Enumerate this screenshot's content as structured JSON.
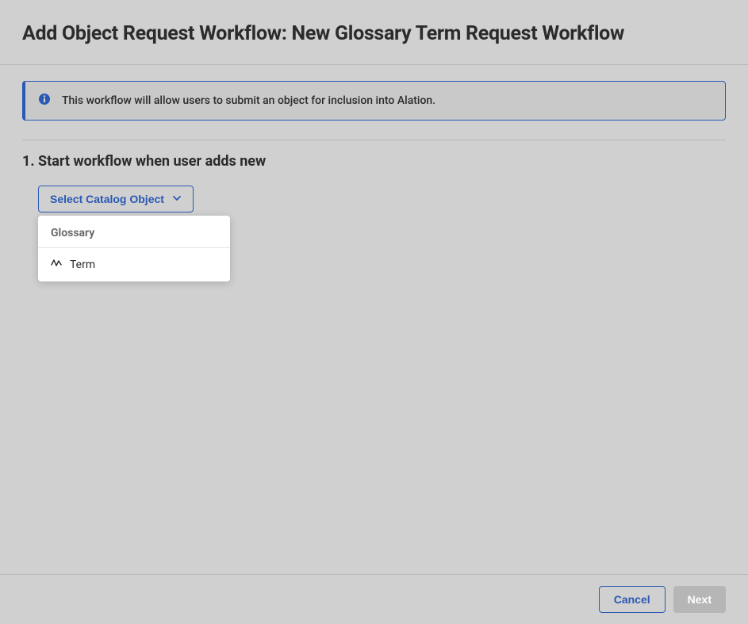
{
  "header": {
    "title": "Add Object Request Workflow: New Glossary Term Request Workflow"
  },
  "banner": {
    "message": "This workflow will allow users to submit an object for inclusion into Alation."
  },
  "step": {
    "heading": "1. Start workflow when user adds new"
  },
  "select": {
    "label": "Select Catalog Object",
    "group_label": "Glossary",
    "options": [
      {
        "label": "Term"
      }
    ]
  },
  "footer": {
    "cancel_label": "Cancel",
    "next_label": "Next"
  }
}
